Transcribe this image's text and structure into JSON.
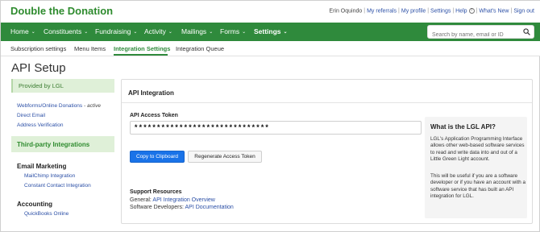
{
  "brand": {
    "name": "Double the Donation",
    "green": "#2f8a3c",
    "link_blue": "#2b4fa6",
    "button_blue": "#1a73e8"
  },
  "userbar": {
    "user": "Erin Oquindo",
    "links": [
      "My referrals",
      "My profile",
      "Settings",
      "Help",
      "What's New",
      "Sign out"
    ],
    "help_icon": "question-circle-icon"
  },
  "nav": {
    "items": [
      {
        "label": "Home",
        "has_menu": true
      },
      {
        "label": "Constituents",
        "has_menu": true
      },
      {
        "label": "Fundraising",
        "has_menu": true
      },
      {
        "label": "Activity",
        "has_menu": true
      },
      {
        "label": "Mailings",
        "has_menu": true
      },
      {
        "label": "Forms",
        "has_menu": true
      },
      {
        "label": "Settings",
        "has_menu": true,
        "active": true
      }
    ],
    "search_placeholder": "Search by name, email or ID",
    "search_icon": "search-icon"
  },
  "subnav": {
    "items": [
      "Subscription settings",
      "Menu Items",
      "Integration Settings",
      "Integration Queue"
    ],
    "active": "Integration Settings"
  },
  "page_title": "API Setup",
  "sidebar": {
    "provided_header": "Provided by LGL",
    "provided_links": [
      {
        "label": "Webforms/Online Donations",
        "status": "- active"
      },
      {
        "label": "Direct Email"
      },
      {
        "label": "Address Verification"
      }
    ],
    "third_party_header": "Third-party Integrations",
    "sections": [
      {
        "title": "Email Marketing",
        "links": [
          "MailChimp Integration",
          "Constant Contact Integration"
        ]
      },
      {
        "title": "Accounting",
        "links": [
          "QuickBooks Online"
        ]
      }
    ]
  },
  "panel": {
    "title": "API Integration",
    "token_label": "API Access Token",
    "token_value": "******************************",
    "copy_button": "Copy to Clipboard",
    "regen_button": "Regenerate Access Token",
    "resources_title": "Support Resources",
    "resources": [
      {
        "prefix": "General:",
        "link": "API Integration Overview"
      },
      {
        "prefix": "Software Developers:",
        "link": "API Documentation"
      }
    ]
  },
  "infobox": {
    "title": "What is the LGL API?",
    "para1": "LGL's Application Programming Interface allows other web-based software services to read and write data into and out of a Little Green Light account.",
    "para2": "This will be useful if you are a software developer or if you have an account with a software service that has built an API integration for LGL."
  }
}
